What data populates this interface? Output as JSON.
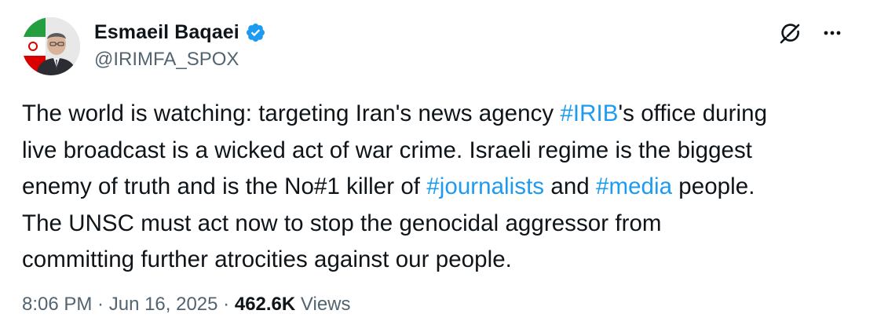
{
  "colors": {
    "text": "#0f1419",
    "secondary": "#536471",
    "link": "#1d9bf0",
    "verified": "#1d9bf0"
  },
  "author": {
    "display_name": "Esmaeil Baqaei",
    "handle": "@IRIMFA_SPOX",
    "verified": true,
    "avatar_icon": "avatar-photo"
  },
  "actions": {
    "grok_icon": "grok-icon",
    "more_icon": "more-icon"
  },
  "tweet": {
    "lines": [
      [
        {
          "t": "The world is watching: targeting Iran's news agency "
        },
        {
          "t": "#IRIB",
          "tag": true
        },
        {
          "t": "'s office during"
        }
      ],
      [
        {
          "t": "live broadcast is a wicked act of war crime. Israeli regime is the biggest"
        }
      ],
      [
        {
          "t": "enemy of truth and is the No#1 killer of "
        },
        {
          "t": "#journalists",
          "tag": true
        },
        {
          "t": " and "
        },
        {
          "t": "#media",
          "tag": true
        },
        {
          "t": " people."
        }
      ],
      [
        {
          "t": "The UNSC must act now to stop the genocidal aggressor from"
        }
      ],
      [
        {
          "t": "committing further atrocities against our people."
        }
      ]
    ]
  },
  "meta": {
    "time": "8:06 PM",
    "separator": " · ",
    "date": "Jun 16, 2025",
    "views_count": "462.6K",
    "views_label": "Views"
  }
}
